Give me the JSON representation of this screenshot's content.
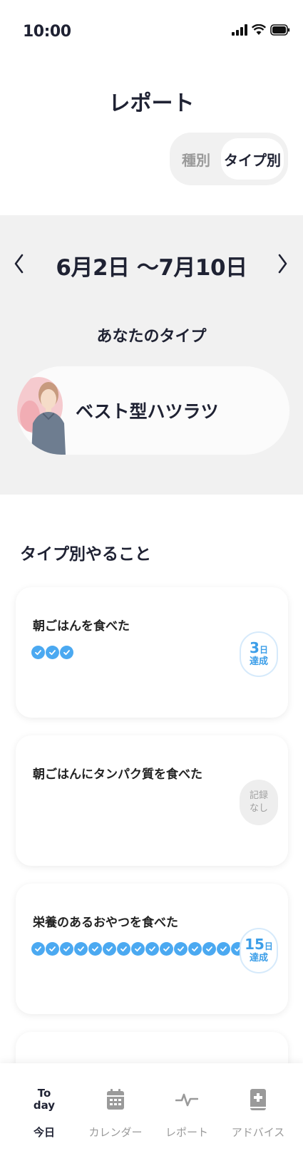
{
  "status_bar": {
    "time": "10:00"
  },
  "header": {
    "title": "レポート"
  },
  "segment": {
    "options": [
      "種別",
      "タイプ別"
    ],
    "selected": "タイプ別"
  },
  "period": {
    "label": "6月2日 〜7月10日"
  },
  "your_type": {
    "label": "あなたのタイプ",
    "name": "ベスト型ハツラツ"
  },
  "section": {
    "title": "タイプ別やること"
  },
  "tasks": [
    {
      "title": "朝ごはんを食べた",
      "checks": 3,
      "badge_num": "3",
      "badge_unit": "日",
      "badge_status": "達成"
    },
    {
      "title": "朝ごはんにタンパク質を食べた",
      "checks": 0,
      "badge_line1": "記録",
      "badge_line2": "なし"
    },
    {
      "title": "栄養のあるおやつを食べた",
      "checks": 15,
      "badge_num": "15",
      "badge_unit": "日",
      "badge_status": "達成"
    }
  ],
  "nav": {
    "today_icon_top": "To",
    "today_icon_bottom": "day",
    "items": [
      "今日",
      "カレンダー",
      "レポート",
      "アドバイス"
    ]
  },
  "colors": {
    "accent": "#4ba9f1",
    "panel": "#f1f1f1",
    "text": "#1f2233"
  }
}
